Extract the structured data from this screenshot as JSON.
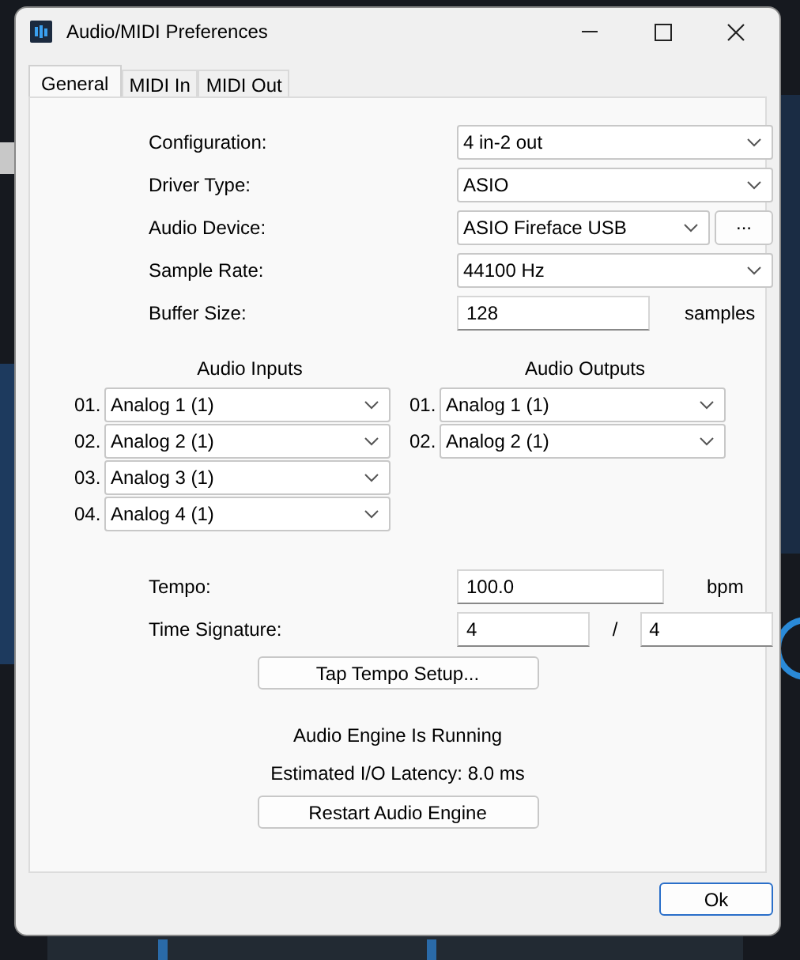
{
  "window": {
    "title": "Audio/MIDI Preferences"
  },
  "tabs": [
    {
      "label": "General",
      "selected": true
    },
    {
      "label": "MIDI In",
      "selected": false
    },
    {
      "label": "MIDI Out",
      "selected": false
    }
  ],
  "settings": [
    {
      "kind": "dropdown",
      "label": "Configuration:",
      "value": "4 in-2 out"
    },
    {
      "kind": "dropdown",
      "label": "Driver Type:",
      "value": "ASIO"
    },
    {
      "kind": "dropdown",
      "label": "Audio Device:",
      "value": "ASIO Fireface USB",
      "button": "..."
    },
    {
      "kind": "dropdown",
      "label": "Sample Rate:",
      "value": "44100 Hz"
    },
    {
      "kind": "field",
      "label": "Buffer Size:",
      "value": "128",
      "unit": "samples"
    }
  ],
  "audio_inputs": {
    "title": "Audio Inputs",
    "channels": [
      {
        "number": "01.",
        "value": "Analog 1 (1)"
      },
      {
        "number": "02.",
        "value": "Analog 2 (1)"
      },
      {
        "number": "03.",
        "value": "Analog 3 (1)"
      },
      {
        "number": "04.",
        "value": "Analog 4 (1)"
      }
    ]
  },
  "audio_outputs": {
    "title": "Audio Outputs",
    "channels": [
      {
        "number": "01.",
        "value": "Analog 1 (1)"
      },
      {
        "number": "02.",
        "value": "Analog 2 (1)"
      }
    ]
  },
  "tempo": {
    "label": "Tempo:",
    "value": "100.0",
    "unit": "bpm"
  },
  "time_signature": {
    "label": "Time Signature:",
    "numerator": "4",
    "separator": "/",
    "denominator": "4"
  },
  "tap_tempo_button": "Tap Tempo Setup...",
  "engine_status": "Audio Engine Is Running",
  "latency": "Estimated I/O Latency: 8.0 ms",
  "restart_button": "Restart Audio Engine",
  "ok_button": "Ok"
}
